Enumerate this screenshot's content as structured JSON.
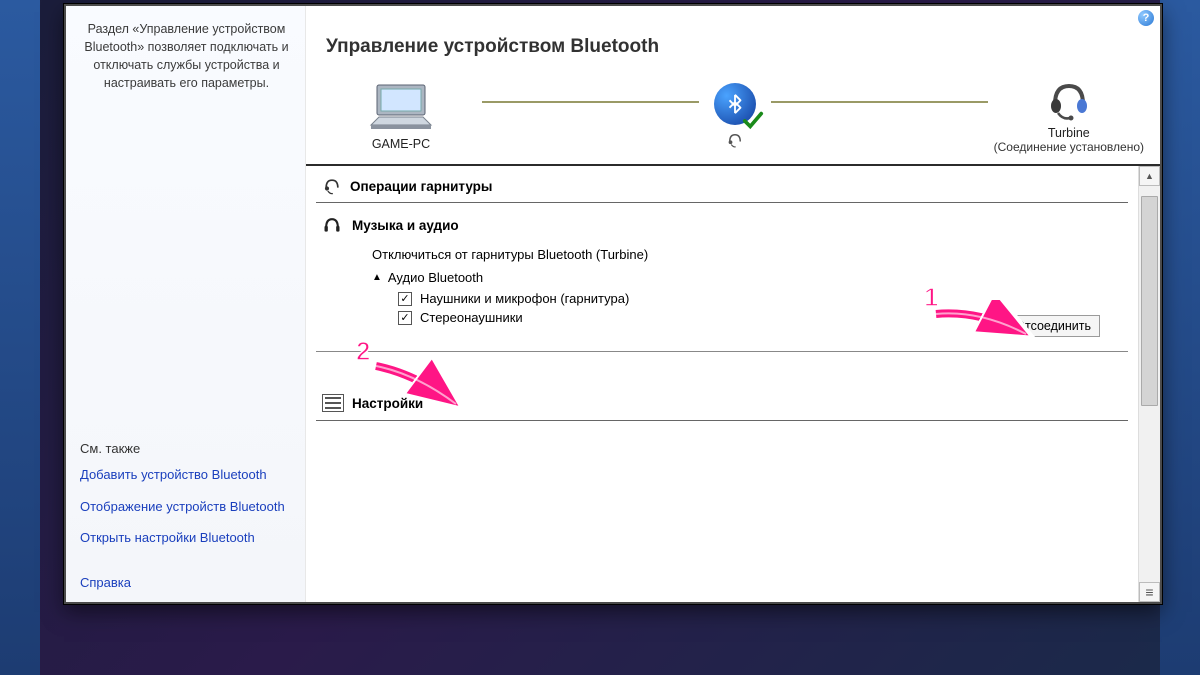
{
  "sidebar": {
    "description": "Раздел «Управление устройством Bluetooth» позволяет подключать и отключать службы устройства и настраивать его параметры.",
    "see_also": "См. также",
    "links": {
      "add_device": "Добавить устройство Bluetooth",
      "show_devices": "Отображение устройств Bluetooth",
      "open_settings": "Открыть настройки Bluetooth"
    },
    "reference": "Справка"
  },
  "main": {
    "title": "Управление устройством Bluetooth",
    "help_tooltip": "?",
    "connection": {
      "pc_name": "GAME-PC",
      "device_name": "Turbine",
      "device_status": "(Соединение установлено)"
    },
    "sections": {
      "headset_ops": "Операции гарнитуры",
      "music_audio": "Музыка и аудио",
      "settings": "Настройки"
    },
    "music": {
      "disconnect_desc": "Отключиться от гарнитуры Bluetooth (Turbine)",
      "audio_bt": "Аудио Bluetooth",
      "cb_headset_mic": "Наушники и микрофон (гарнитура)",
      "cb_stereo": "Стереонаушники",
      "disconnect_btn": "Отсоединить"
    }
  },
  "annotations": {
    "num1": "1",
    "num2": "2"
  }
}
